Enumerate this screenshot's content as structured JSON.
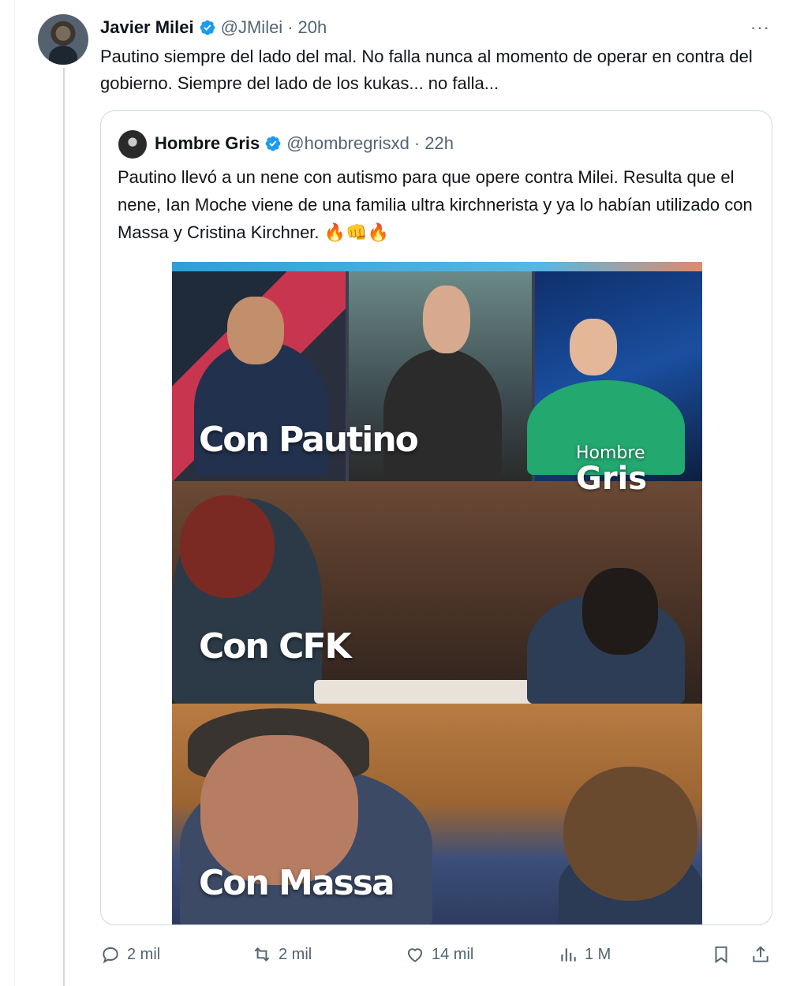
{
  "author": {
    "name": "Javier Milei",
    "handle": "@JMilei",
    "separator": "·",
    "time": "20h",
    "more": "···"
  },
  "tweet": {
    "text": "Pautino siempre del lado del mal. No falla nunca al momento de operar en contra del gobierno. Siempre del lado de los kukas... no falla..."
  },
  "quote": {
    "name": "Hombre Gris",
    "handle": "@hombregrisxd",
    "separator": "·",
    "time": "22h",
    "text": "Pautino llevó a un nene con autismo para  que opere contra Milei. Resulta que el nene, Ian Moche viene de una familia ultra kirchnerista y ya lo habían utilizado con Massa y Cristina Kirchner.",
    "emojis": [
      "🔥",
      "👊",
      "🔥"
    ],
    "media": {
      "captions": [
        "Con Pautino",
        "Con CFK",
        "Con Massa"
      ],
      "watermark_line1": "Hombre",
      "watermark_line2": "Gris"
    }
  },
  "actions": {
    "replies": "2 mil",
    "reposts": "2 mil",
    "likes": "14 mil",
    "views": "1 M"
  },
  "colors": {
    "verified": "#1d9bf0",
    "muted": "#536471",
    "border": "#cfd9de"
  }
}
